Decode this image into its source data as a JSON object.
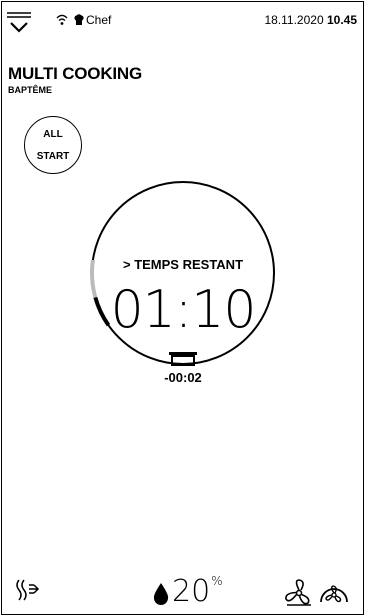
{
  "status": {
    "user": "Chef",
    "date": "18.11.2020",
    "time": "10.45"
  },
  "program": {
    "title": "MULTI COOKING",
    "subtitle": "BAPTÊME"
  },
  "all_start": {
    "line1": "ALL",
    "line2": "START"
  },
  "timer": {
    "label": "> TEMPS RESTANT",
    "value": "01:10",
    "offset": "-00:02",
    "progress_fraction": 0.12
  },
  "bottom": {
    "humidity_value": "20",
    "humidity_unit": "%"
  },
  "icons": [
    "menu-icon",
    "wifi-icon",
    "chef-hat-icon",
    "tray-icon",
    "steam-icon",
    "drop-icon",
    "fan-icon",
    "fan-speed-icon"
  ]
}
